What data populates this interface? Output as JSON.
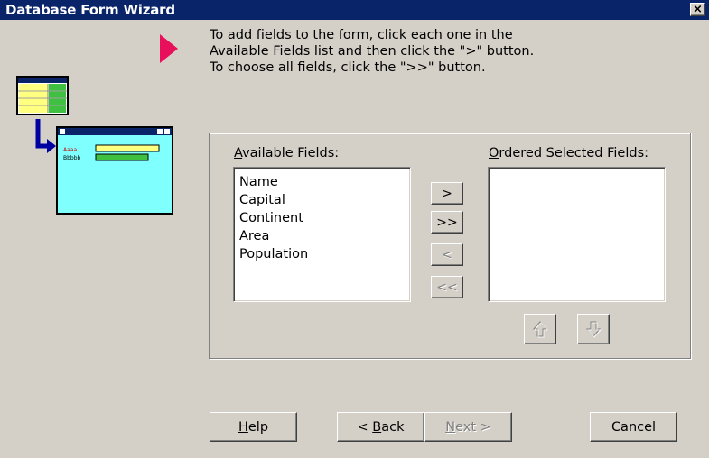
{
  "window": {
    "title": "Database Form Wizard",
    "close_label": "×"
  },
  "instructions": [
    "To add fields to the form, click each one in the",
    "Available Fields list and then click the \">\" button.",
    "To choose all fields, click the \">>\" button."
  ],
  "available": {
    "label_accel": "A",
    "label_rest": "vailable Fields:",
    "items": [
      "Name",
      "Capital",
      "Continent",
      "Area",
      "Population"
    ]
  },
  "selected": {
    "label_accel": "O",
    "label_rest": "rdered Selected Fields:",
    "items": []
  },
  "move_buttons": {
    "add": ">",
    "add_all": ">>",
    "remove": "<",
    "remove_all": "<<"
  },
  "order_buttons": {
    "up_icon": "up-arrow-icon",
    "down_icon": "down-arrow-icon"
  },
  "footer": {
    "help_accel": "H",
    "help_rest": "elp",
    "back_pre": "< ",
    "back_accel": "B",
    "back_rest": "ack",
    "next_accel": "N",
    "next_rest": "ext >",
    "cancel": "Cancel"
  },
  "colors": {
    "titlebar": "#0a246a",
    "dialog_bg": "#d4d0c8",
    "marker": "#e8105a",
    "illus_window": "#80ffff",
    "illus_arrow": "#0000a0"
  }
}
